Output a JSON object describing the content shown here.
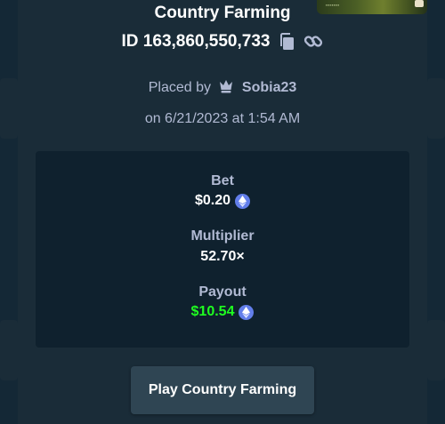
{
  "bet_modal": {
    "game_title": "Country Farming",
    "bet_id": "ID 163,860,550,733",
    "placed_by_prefix": "Placed by",
    "username": "Sobia23",
    "placed_on": "on 6/21/2023 at 1:54 AM",
    "bet_label": "Bet",
    "bet_value": "$0.20",
    "multiplier_label": "Multiplier",
    "multiplier_value": "52.70×",
    "payout_label": "Payout",
    "payout_value": "$10.54",
    "play_button_label": "Play Country Farming",
    "currency_icon": "ethereum-icon"
  },
  "colors": {
    "page_bg": "#0f212e",
    "modal_bg": "#1a2c38",
    "stats_bg": "#0f212e",
    "muted_text": "#b1bad3",
    "payout_green": "#1fff20",
    "eth_blue": "#627eea",
    "button_bg": "#2f4553"
  }
}
